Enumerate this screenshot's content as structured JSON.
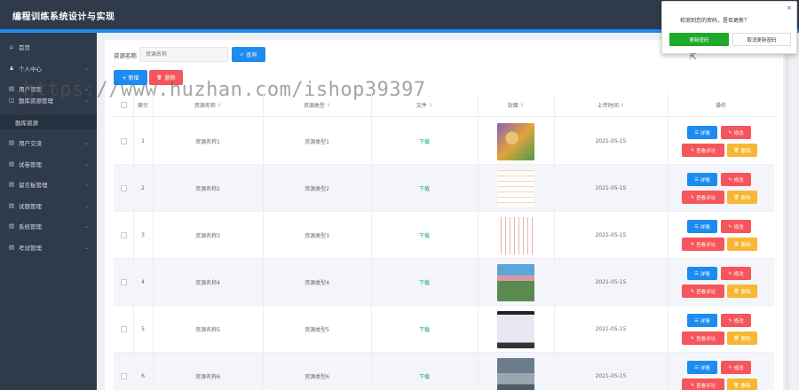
{
  "app": {
    "title": "编程训练系统设计与实现"
  },
  "sidebar": {
    "items": [
      {
        "label": "首页",
        "icon": "home-icon",
        "glyph": "⌂",
        "has_chevron": false
      },
      {
        "label": "个人中心",
        "icon": "user-icon",
        "glyph": "♟",
        "has_chevron": true
      },
      {
        "label": "用户管理",
        "icon": "users-icon",
        "glyph": "▤",
        "has_chevron": true
      },
      {
        "label": "题库资源管理",
        "icon": "resource-icon",
        "glyph": "◫",
        "has_chevron": true
      },
      {
        "label": "题库资源",
        "icon": "",
        "glyph": "",
        "has_chevron": false,
        "sub": true
      },
      {
        "label": "用户交流",
        "icon": "chat-icon",
        "glyph": "▤",
        "has_chevron": true
      },
      {
        "label": "试卷管理",
        "icon": "paper-icon",
        "glyph": "▤",
        "has_chevron": true
      },
      {
        "label": "留言板管理",
        "icon": "board-icon",
        "glyph": "▤",
        "has_chevron": true
      },
      {
        "label": "试题管理",
        "icon": "question-icon",
        "glyph": "▤",
        "has_chevron": true
      },
      {
        "label": "系统管理",
        "icon": "system-icon",
        "glyph": "▤",
        "has_chevron": true
      },
      {
        "label": "考试管理",
        "icon": "exam-icon",
        "glyph": "▤",
        "has_chevron": true
      }
    ]
  },
  "search": {
    "label": "资源名称",
    "placeholder": "资源名称",
    "button": "查询",
    "button_icon": "⌕"
  },
  "actions": {
    "add": "+ 新增",
    "delete": "删除",
    "delete_icon": "🗑"
  },
  "table": {
    "columns": [
      "",
      "索引",
      "资源名称",
      "资源类型",
      "文件",
      "封面",
      "上传时间",
      "操作"
    ],
    "rows": [
      {
        "index": "1",
        "name": "资源名称1",
        "type": "资源类型1",
        "file": "下载",
        "cover": "cartoon-cover",
        "time": "2021-05-15"
      },
      {
        "index": "2",
        "name": "资源名称2",
        "type": "资源类型2",
        "file": "下载",
        "cover": "mindmap-cover",
        "time": "2021-05-15"
      },
      {
        "index": "3",
        "name": "资源名称3",
        "type": "资源类型3",
        "file": "下载",
        "cover": "chart-cover",
        "time": "2021-05-15"
      },
      {
        "index": "4",
        "name": "资源名称4",
        "type": "资源类型4",
        "file": "下载",
        "cover": "classroom-cover",
        "time": "2021-05-15"
      },
      {
        "index": "5",
        "name": "资源名称5",
        "type": "资源类型5",
        "file": "下载",
        "cover": "screen-cover",
        "time": "2021-05-15"
      },
      {
        "index": "6",
        "name": "资源名称6",
        "type": "资源类型6",
        "file": "下载",
        "cover": "lab-cover",
        "time": "2021-05-15"
      }
    ],
    "row_actions": {
      "detail": "详情",
      "edit": "修改",
      "comments": "查看评论",
      "delete": "删除"
    }
  },
  "watermark": "https://www.huzhan.com/ishop39397",
  "popup": {
    "message": "检测到您的密码，是否更新？",
    "confirm": "更新密码",
    "cancel": "取消更新密码",
    "close": "×"
  },
  "colors": {
    "primary": "#1d8cf0",
    "danger": "#f5565c",
    "warning": "#f7b733",
    "success": "#19a85c",
    "sidebar": "#2f3a4a"
  }
}
